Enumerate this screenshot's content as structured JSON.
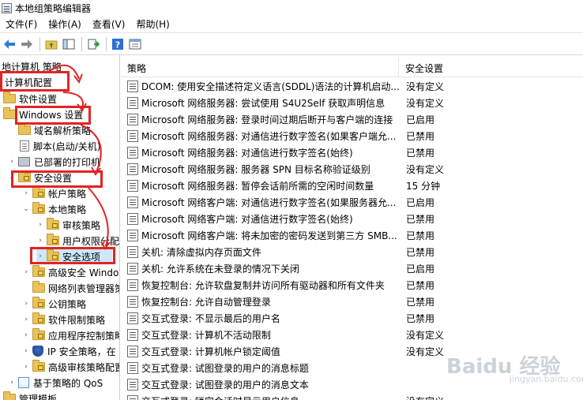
{
  "window": {
    "title": "本地组策略编辑器"
  },
  "menu": [
    "文件(F)",
    "操作(A)",
    "查看(V)",
    "帮助(H)"
  ],
  "toolbar": {
    "icons": [
      "back-arrow",
      "forward-arrow",
      "folder-up",
      "show-hide-tree",
      "export-list",
      "help",
      "properties"
    ]
  },
  "tree": {
    "items": [
      {
        "label": "地计算机 策略",
        "level": 0,
        "icon": "none"
      },
      {
        "label": "计算机配置",
        "level": 0,
        "icon": "none"
      },
      {
        "label": "软件设置",
        "level": 1,
        "icon": "folder"
      },
      {
        "label": "Windows 设置",
        "level": 1,
        "icon": "folder"
      },
      {
        "label": "域名解析策略",
        "level": 2,
        "icon": "folder"
      },
      {
        "label": "脚本(启动/关机)",
        "level": 2,
        "icon": "document"
      },
      {
        "label": "已部署的打印机",
        "level": 2,
        "icon": "printer"
      },
      {
        "label": "安全设置",
        "level": 2,
        "icon": "folder-locked"
      },
      {
        "label": "帐户策略",
        "level": 3,
        "icon": "folder-locked"
      },
      {
        "label": "本地策略",
        "level": 3,
        "icon": "folder-locked"
      },
      {
        "label": "审核策略",
        "level": 4,
        "icon": "folder-locked"
      },
      {
        "label": "用户权限分配",
        "level": 4,
        "icon": "folder-locked"
      },
      {
        "label": "安全选项",
        "level": 4,
        "icon": "folder-locked"
      },
      {
        "label": "高级安全 Windows",
        "level": 3,
        "icon": "folder-locked"
      },
      {
        "label": "网络列表管理器策略",
        "level": 3,
        "icon": "folder"
      },
      {
        "label": "公钥策略",
        "level": 3,
        "icon": "folder-locked"
      },
      {
        "label": "软件限制策略",
        "level": 3,
        "icon": "folder-locked"
      },
      {
        "label": "应用程序控制策略",
        "level": 3,
        "icon": "folder-locked"
      },
      {
        "label": "IP 安全策略，在",
        "level": 3,
        "icon": "shield"
      },
      {
        "label": "高级审核策略配置",
        "level": 3,
        "icon": "folder-locked"
      },
      {
        "label": "基于策略的 QoS",
        "level": 2,
        "icon": "chart"
      },
      {
        "label": "管理模板",
        "level": 1,
        "icon": "folder"
      }
    ]
  },
  "list": {
    "headers": {
      "policy": "策略",
      "setting": "安全设置"
    },
    "rows": [
      {
        "policy": "DCOM: 使用安全描述符定义语言(SDDL)语法的计算机启动...",
        "setting": "没有定义"
      },
      {
        "policy": "Microsoft 网络服务器: 尝试使用 S4U2Self 获取声明信息",
        "setting": "没有定义"
      },
      {
        "policy": "Microsoft 网络服务器: 登录时间过期后断开与客户端的连接",
        "setting": "已启用"
      },
      {
        "policy": "Microsoft 网络服务器: 对通信进行数字签名(如果客户端允...",
        "setting": "已禁用"
      },
      {
        "policy": "Microsoft 网络服务器: 对通信进行数字签名(始终)",
        "setting": "已禁用"
      },
      {
        "policy": "Microsoft 网络服务器: 服务器 SPN 目标名称验证级别",
        "setting": "没有定义"
      },
      {
        "policy": "Microsoft 网络服务器: 暂停会话前所需的空闲时间数量",
        "setting": "15 分钟"
      },
      {
        "policy": "Microsoft 网络客户端: 对通信进行数字签名(如果服务器允...",
        "setting": "已启用"
      },
      {
        "policy": "Microsoft 网络客户端: 对通信进行数字签名(始终)",
        "setting": "已禁用"
      },
      {
        "policy": "Microsoft 网络客户端: 将未加密的密码发送到第三方 SMB...",
        "setting": "已禁用"
      },
      {
        "policy": "关机: 清除虚拟内存页面文件",
        "setting": "已禁用"
      },
      {
        "policy": "关机: 允许系统在未登录的情况下关闭",
        "setting": "已启用"
      },
      {
        "policy": "恢复控制台: 允许软盘复制并访问所有驱动器和所有文件夹",
        "setting": "已禁用"
      },
      {
        "policy": "恢复控制台: 允许自动管理登录",
        "setting": "已禁用"
      },
      {
        "policy": "交互式登录: 不显示最后的用户名",
        "setting": "已禁用"
      },
      {
        "policy": "交互式登录: 计算机不活动限制",
        "setting": "没有定义"
      },
      {
        "policy": "交互式登录: 计算机帐户锁定阈值",
        "setting": "没有定义"
      },
      {
        "policy": "交互式登录: 试图登录的用户的消息标题",
        "setting": ""
      },
      {
        "policy": "交互式登录: 试图登录的用户的消息文本",
        "setting": ""
      },
      {
        "policy": "交互式登录: 锁定会话时显示用户信息",
        "setting": "没有定义"
      }
    ]
  },
  "watermark": {
    "brand": "Baidu 经验",
    "url": "jingyan.baidu.com"
  },
  "colors": {
    "highlight": "#e02424",
    "selection": "#cce8ff"
  }
}
